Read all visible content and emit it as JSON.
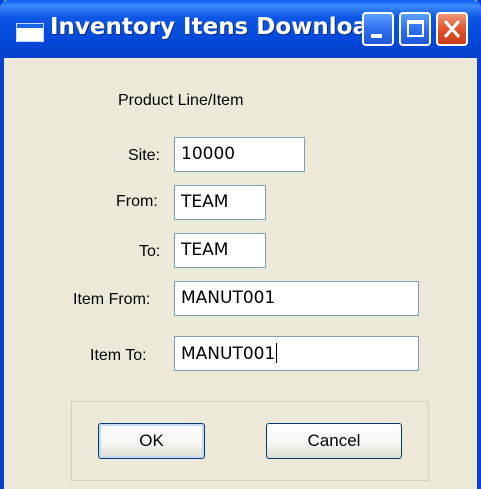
{
  "window": {
    "title": "Inventory Itens Download"
  },
  "form": {
    "heading": "Product Line/Item",
    "site_label": "Site:",
    "site_value": "10000",
    "from_label": "From:",
    "from_value": "TEAM",
    "to_label": "To:",
    "to_value": "TEAM",
    "item_from_label": "Item From:",
    "item_from_value": "MANUT001",
    "item_to_label": "Item To:",
    "item_to_value": "MANUT001"
  },
  "buttons": {
    "ok_label": "OK",
    "cancel_label": "Cancel"
  },
  "icons": {
    "window_icon": "window-app-icon",
    "minimize": "minimize-icon",
    "maximize": "maximize-icon",
    "close": "close-icon"
  },
  "colors": {
    "titlebar": "#0349d9",
    "dialog_background": "#ece9d8",
    "close_button": "#e0542e"
  }
}
